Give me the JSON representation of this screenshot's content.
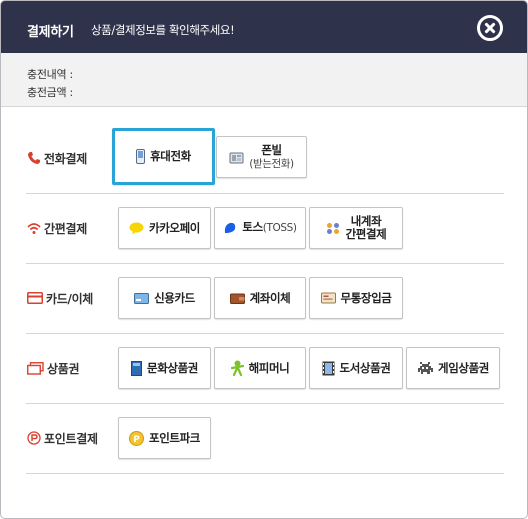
{
  "header": {
    "title": "결제하기",
    "subtitle": "상품/결제정보를 확인해주세요!"
  },
  "info": {
    "charge_detail_label": "충전내역 :",
    "charge_amount_label": "충전금액 :"
  },
  "categories": {
    "phone": {
      "label": "전화결제",
      "buttons": {
        "mobile": "휴대전화",
        "phonebill": "폰빌",
        "phonebill_sub": "(받는전화)"
      }
    },
    "simple": {
      "label": "간편결제",
      "buttons": {
        "kakaopay": "카카오페이",
        "toss": "토스",
        "toss_sub": "(TOSS)",
        "myaccount_1": "내계좌",
        "myaccount_2": "간편결제"
      }
    },
    "card": {
      "label": "카드/이체",
      "buttons": {
        "credit": "신용카드",
        "transfer": "계좌이체",
        "deposit": "무통장입금"
      }
    },
    "giftcard": {
      "label": "상품권",
      "buttons": {
        "culture": "문화상품권",
        "happymoney": "해피머니",
        "book": "도서상품권",
        "game": "게임상품권"
      }
    },
    "point": {
      "label": "포인트결제",
      "buttons": {
        "pointpark": "포인트파크"
      }
    }
  },
  "colors": {
    "header_bg": "#2f324b",
    "selected_border": "#2aa3d8",
    "category_icon": "#d9412f"
  }
}
